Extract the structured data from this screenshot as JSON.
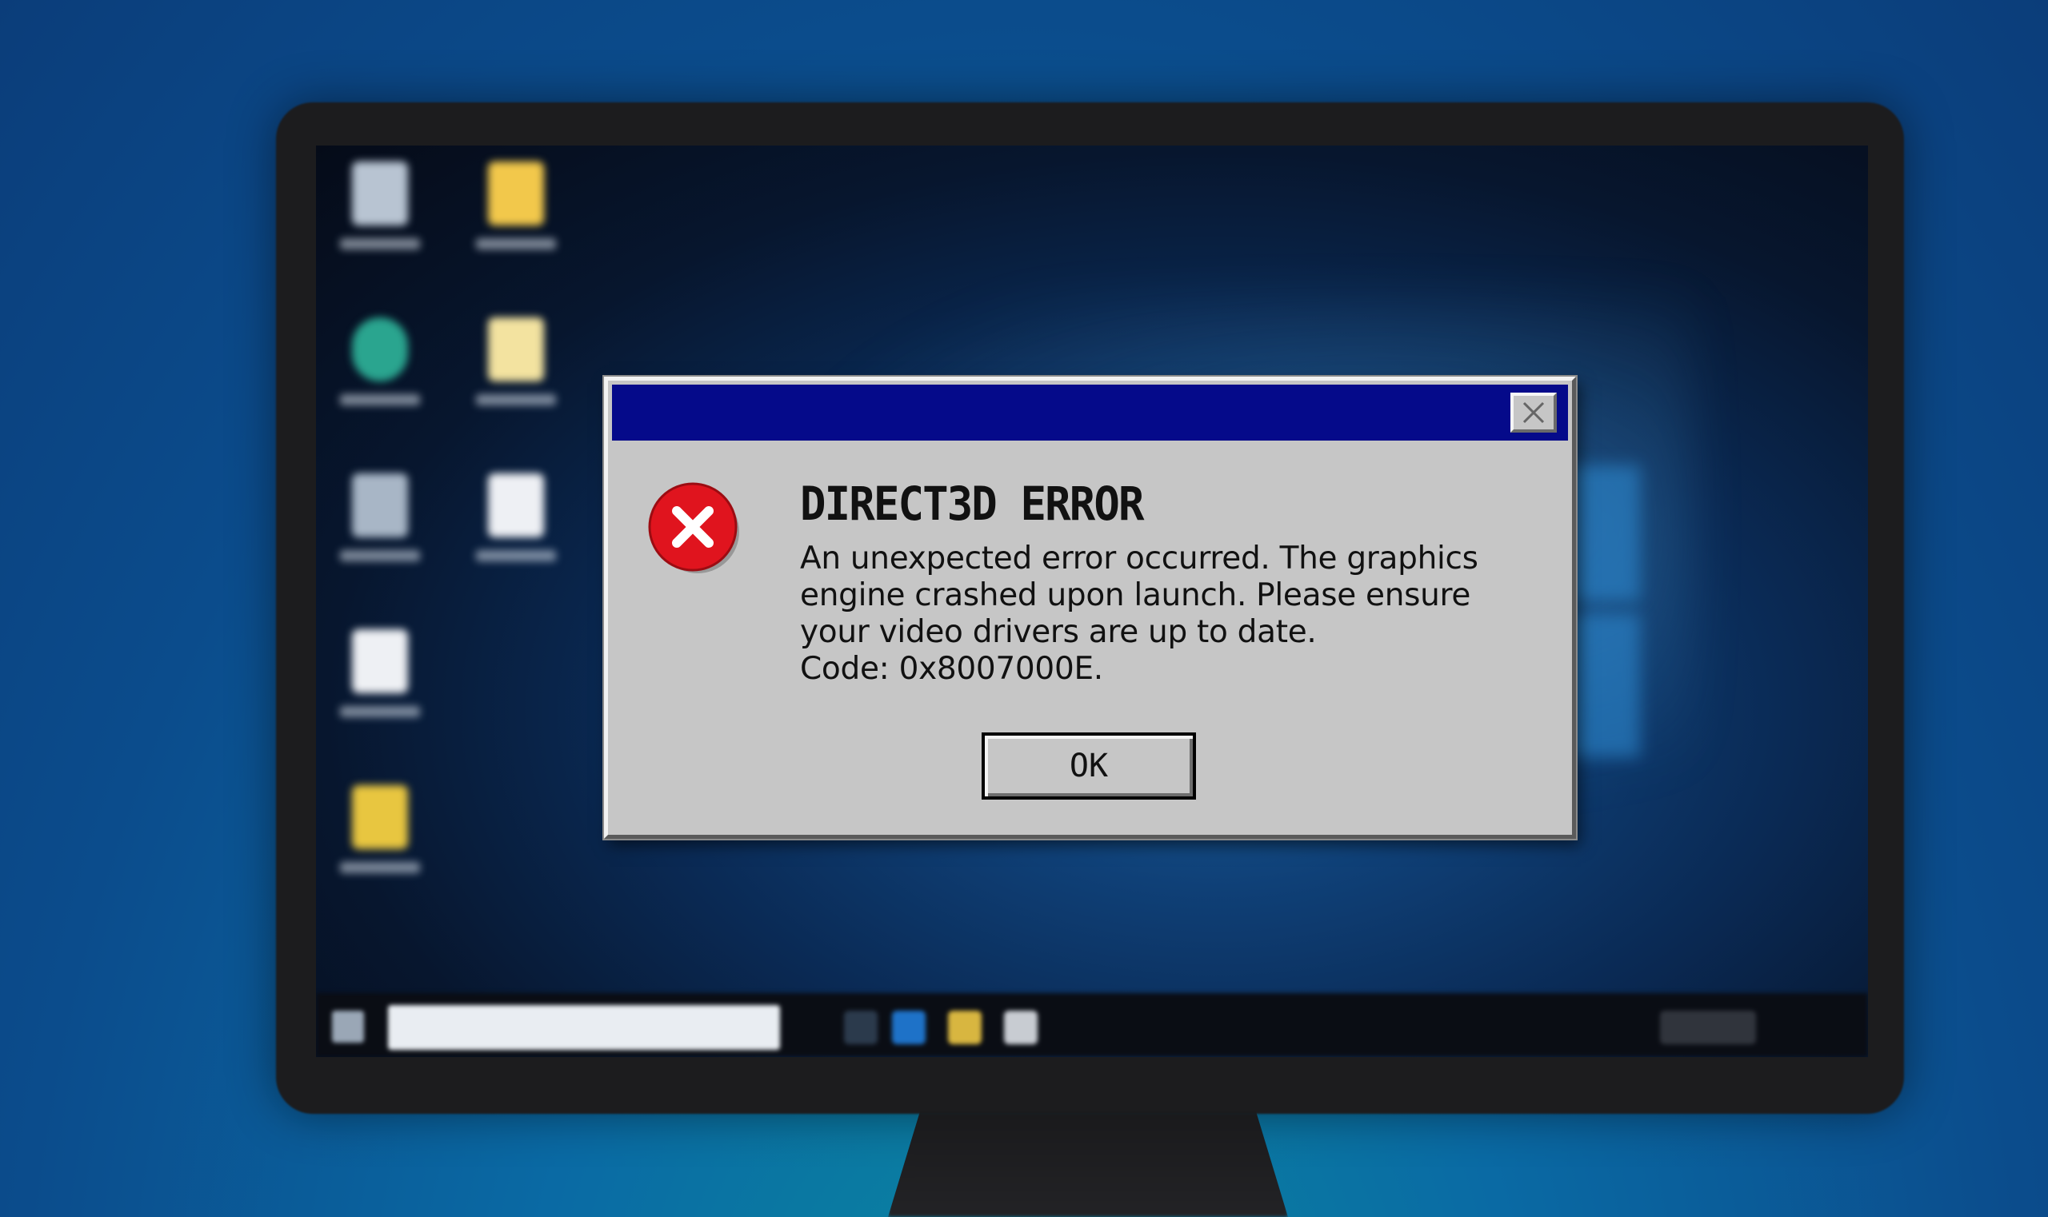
{
  "dialog": {
    "title": "",
    "heading": "DIRECT3D ERROR",
    "message_lines": [
      "An unexpected error occurred. The graphics",
      "engine crashed upon launch. Please ensure",
      "your video drivers are up to date.",
      "Code: 0x8007000E."
    ],
    "ok_label": "OK",
    "icon": "error-x-icon",
    "colors": {
      "titlebar": "#050a8a",
      "body": "#c6c6c6",
      "error_icon": "#e0141e"
    }
  },
  "desktop": {
    "icons": [
      "recycle-bin-icon",
      "folder-icon",
      "edge-browser-icon",
      "file-icon",
      "recycle-bin-icon",
      "document-icon",
      "document-icon",
      "media-file-icon"
    ]
  },
  "taskbar": {
    "items": [
      "start-button",
      "search-box",
      "task-view-icon",
      "edge-icon",
      "file-explorer-icon",
      "store-icon"
    ]
  }
}
